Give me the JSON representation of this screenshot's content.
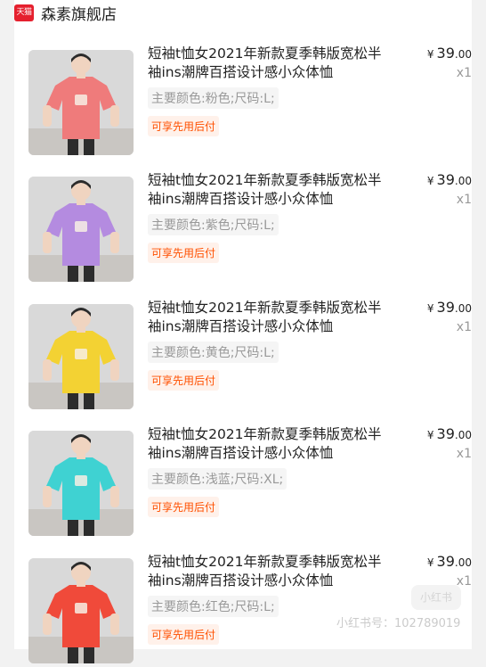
{
  "shop": {
    "logo_text": "天猫",
    "name": "森素旗舰店"
  },
  "items": [
    {
      "title": "短袖t恤女2021年新款夏季韩版宽松半袖ins潮牌百搭设计感小众体恤",
      "spec": "主要颜色:粉色;尺码:L;",
      "tag": "可享先用后付",
      "currency": "¥",
      "price_int": "39",
      "price_dec": ".00",
      "qty": "x1",
      "shirt_color": "#ef7b7b"
    },
    {
      "title": "短袖t恤女2021年新款夏季韩版宽松半袖ins潮牌百搭设计感小众体恤",
      "spec": "主要颜色:紫色;尺码:L;",
      "tag": "可享先用后付",
      "currency": "¥",
      "price_int": "39",
      "price_dec": ".00",
      "qty": "x1",
      "shirt_color": "#b48be0"
    },
    {
      "title": "短袖t恤女2021年新款夏季韩版宽松半袖ins潮牌百搭设计感小众体恤",
      "spec": "主要颜色:黄色;尺码:L;",
      "tag": "可享先用后付",
      "currency": "¥",
      "price_int": "39",
      "price_dec": ".00",
      "qty": "x1",
      "shirt_color": "#f3d233"
    },
    {
      "title": "短袖t恤女2021年新款夏季韩版宽松半袖ins潮牌百搭设计感小众体恤",
      "spec": "主要颜色:浅蓝;尺码:XL;",
      "tag": "可享先用后付",
      "currency": "¥",
      "price_int": "39",
      "price_dec": ".00",
      "qty": "x1",
      "shirt_color": "#3fd2d2"
    },
    {
      "title": "短袖t恤女2021年新款夏季韩版宽松半袖ins潮牌百搭设计感小众体恤",
      "spec": "主要颜色:红色;尺码:L;",
      "tag": "可享先用后付",
      "currency": "¥",
      "price_int": "39",
      "price_dec": ".00",
      "qty": "x1",
      "shirt_color": "#f04a3a"
    }
  ],
  "watermark": {
    "text": "小红书号：102789019",
    "badge": "小红书"
  }
}
